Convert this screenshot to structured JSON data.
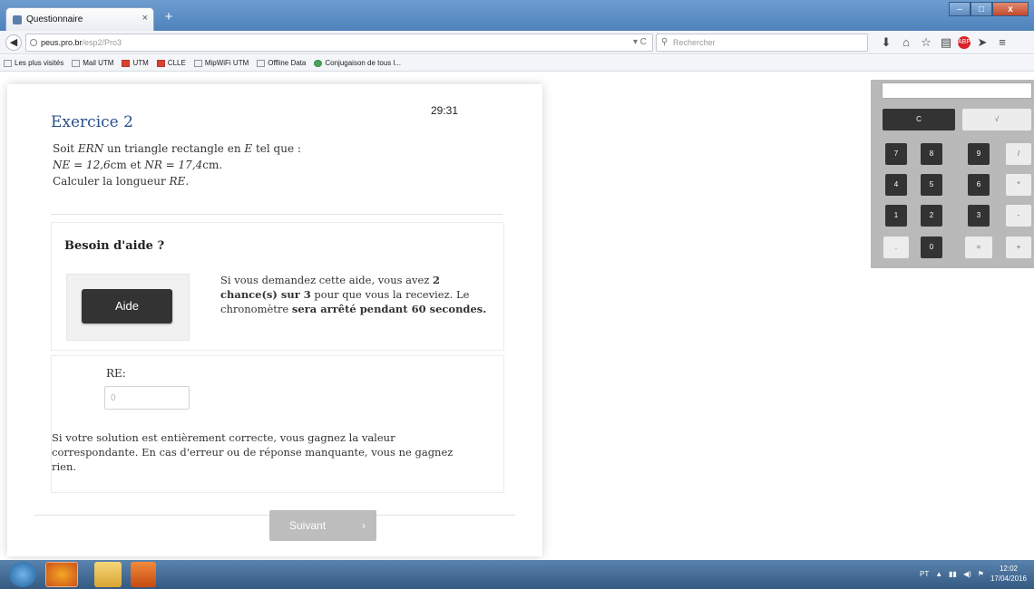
{
  "browser": {
    "tab_title": "Questionnaire",
    "tab_close": "×",
    "new_tab": "+",
    "url_host": "peus.pro.br",
    "url_path": "/esp2/Pro3",
    "search_placeholder": "Rechercher",
    "window_controls": {
      "minimize": "–",
      "maximize": "□",
      "close": "x"
    },
    "bookmarks": [
      "Les plus visités",
      "Mail UTM",
      "UTM",
      "CLLE",
      "MipWiFi UTM",
      "Offline Data",
      "Conjugaison de tous l..."
    ]
  },
  "exercise": {
    "timer": "29:31",
    "title": "Exercice 2",
    "statement_line1_a": "Soit ",
    "statement_line1_m1": "ERN",
    "statement_line1_b": " un triangle rectangle en ",
    "statement_line1_m2": "E",
    "statement_line1_c": " tel que :",
    "statement_line2_m1": "NE = 12,6",
    "statement_line2_u1": "cm et ",
    "statement_line2_m2": "NR = 17,4",
    "statement_line2_u2": "cm.",
    "statement_line3_a": "Calculer la longueur ",
    "statement_line3_m": "RE",
    "statement_line3_b": "."
  },
  "help": {
    "title": "Besoin d'aide ?",
    "button_label": "Aide",
    "text_a": "Si vous demandez cette aide, vous avez ",
    "text_b": "2 chance(s) sur 3",
    "text_c": " pour que vous la receviez. Le chronomètre ",
    "text_d": "sera arrêté pendant 60 secondes."
  },
  "answer": {
    "label": "RE:",
    "value": "0",
    "note": "Si votre solution est entièrement correcte, vous gagnez la valeur correspondante. En cas d'erreur ou de réponse manquante, vous ne gagnez rien."
  },
  "footer": {
    "next_label": "Suivant",
    "next_chevron": "›"
  },
  "calculator": {
    "clear": "C",
    "sqrt": "√",
    "keys": [
      "7",
      "8",
      "9",
      "/",
      "4",
      "5",
      "6",
      "*",
      "1",
      "2",
      "3",
      "-",
      ".",
      "0",
      "=",
      "+"
    ]
  },
  "taskbar": {
    "tray_lang": "PT",
    "time": "12:02",
    "date": "17/04/2016"
  }
}
